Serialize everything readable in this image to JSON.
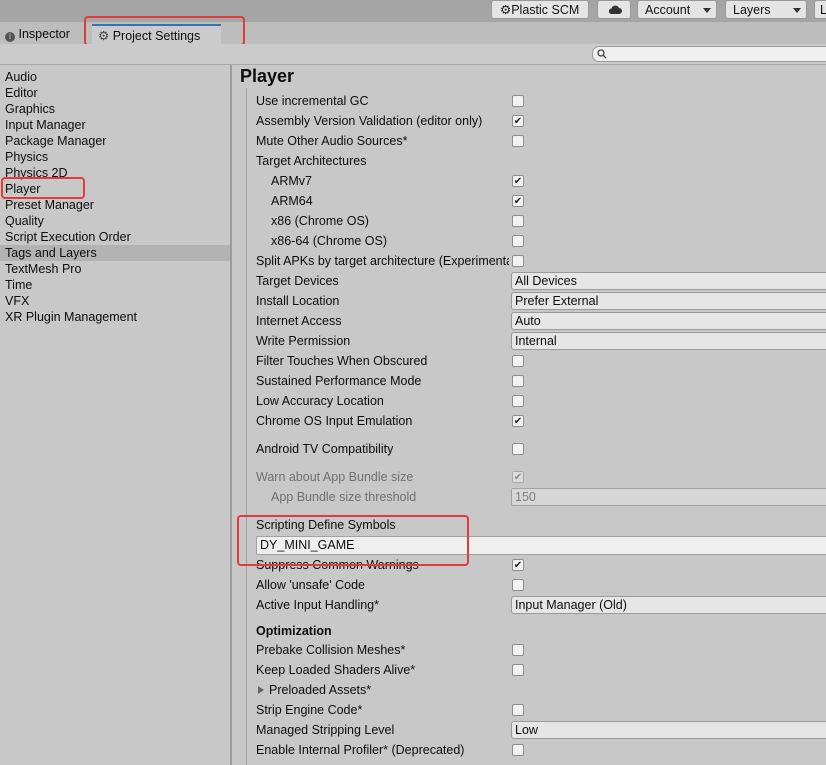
{
  "toolbar": {
    "plastic_label": "Plastic SCM",
    "account_label": "Account",
    "layers_label": "Layers",
    "layout_label": "L"
  },
  "tabs": {
    "inspector": "Inspector",
    "project_settings": "Project Settings"
  },
  "sidebar": {
    "items": [
      "Audio",
      "Editor",
      "Graphics",
      "Input Manager",
      "Package Manager",
      "Physics",
      "Physics 2D",
      "Player",
      "Preset Manager",
      "Quality",
      "Script Execution Order",
      "Tags and Layers",
      "TextMesh Pro",
      "Time",
      "VFX",
      "XR Plugin Management"
    ],
    "selected": "Player"
  },
  "main": {
    "title": "Player",
    "rows": [
      {
        "label": "Use incremental GC",
        "checked": false
      },
      {
        "label": "Assembly Version Validation (editor only)",
        "checked": true
      },
      {
        "label": "Mute Other Audio Sources*",
        "checked": false
      },
      {
        "label": "Target Architectures"
      },
      {
        "label": "ARMv7",
        "checked": true
      },
      {
        "label": "ARM64",
        "checked": true
      },
      {
        "label": "x86 (Chrome OS)",
        "checked": false
      },
      {
        "label": "x86-64 (Chrome OS)",
        "checked": false
      },
      {
        "label": "Split APKs by target architecture (Experimental)",
        "checked": false
      },
      {
        "label": "Target Devices",
        "value": "All Devices"
      },
      {
        "label": "Install Location",
        "value": "Prefer External"
      },
      {
        "label": "Internet Access",
        "value": "Auto"
      },
      {
        "label": "Write Permission",
        "value": "Internal"
      },
      {
        "label": "Filter Touches When Obscured",
        "checked": false
      },
      {
        "label": "Sustained Performance Mode",
        "checked": false
      },
      {
        "label": "Low Accuracy Location",
        "checked": false
      },
      {
        "label": "Chrome OS Input Emulation",
        "checked": true
      },
      {
        "label": "Android TV Compatibility",
        "checked": false
      },
      {
        "label": "Warn about App Bundle size",
        "checked": true
      },
      {
        "label": "App Bundle size threshold",
        "value": "150"
      },
      {
        "label": "Scripting Define Symbols",
        "value": "DY_MINI_GAME"
      },
      {
        "label": "Suppress Common Warnings",
        "checked": true
      },
      {
        "label": "Allow 'unsafe' Code",
        "checked": false
      },
      {
        "label": "Active Input Handling*",
        "value": "Input Manager (Old)"
      },
      {
        "label": "Optimization"
      },
      {
        "label": "Prebake Collision Meshes*",
        "checked": false
      },
      {
        "label": "Keep Loaded Shaders Alive*",
        "checked": false
      },
      {
        "label": "Preloaded Assets*"
      },
      {
        "label": "Strip Engine Code*",
        "checked": false
      },
      {
        "label": "Managed Stripping Level",
        "value": "Low"
      },
      {
        "label": "Enable Internal Profiler* (Deprecated)",
        "checked": false
      }
    ]
  },
  "icons": {
    "gear": "gear-icon",
    "info": "info-icon",
    "cloud": "cloud-icon",
    "search": "search-icon",
    "foldout": "foldout-arrow-icon"
  },
  "colors": {
    "highlight": "#e03c3c",
    "tab_accent": "#3a72b0",
    "selection": "#b3b3b3"
  }
}
